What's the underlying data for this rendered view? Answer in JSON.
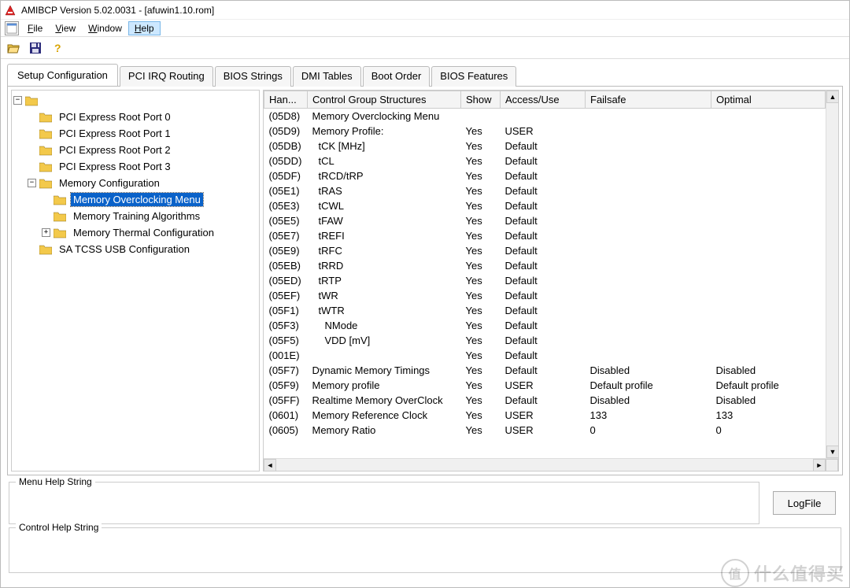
{
  "window": {
    "title": "AMIBCP Version 5.02.0031 - [afuwin1.10.rom]"
  },
  "menu": {
    "file": "File",
    "view": "View",
    "window": "Window",
    "help": "Help"
  },
  "toolbar": {
    "open_icon": "open-folder-icon",
    "save_icon": "save-icon",
    "help_icon": "help-icon"
  },
  "tabs": [
    {
      "label": "Setup Configuration",
      "active": true
    },
    {
      "label": "PCI IRQ Routing",
      "active": false
    },
    {
      "label": "BIOS Strings",
      "active": false
    },
    {
      "label": "DMI Tables",
      "active": false
    },
    {
      "label": "Boot Order",
      "active": false
    },
    {
      "label": "BIOS Features",
      "active": false
    }
  ],
  "tree": {
    "root": {
      "label": ""
    },
    "items": [
      {
        "label": "PCI Express Root Port 0",
        "depth": 1
      },
      {
        "label": "PCI Express Root Port 1",
        "depth": 1
      },
      {
        "label": "PCI Express Root Port 2",
        "depth": 1
      },
      {
        "label": "PCI Express Root Port 3",
        "depth": 1
      },
      {
        "label": "Memory Configuration",
        "depth": 1,
        "expandable": "-"
      },
      {
        "label": "Memory Overclocking Menu",
        "depth": 2,
        "selected": true
      },
      {
        "label": "Memory Training Algorithms",
        "depth": 2
      },
      {
        "label": "Memory Thermal Configuration",
        "depth": 2,
        "expandable": "+"
      },
      {
        "label": "SA TCSS USB Configuration",
        "depth": 1
      }
    ]
  },
  "table": {
    "headers": {
      "han": "Han...",
      "cgs": "Control Group Structures",
      "show": "Show",
      "access": "Access/Use",
      "failsafe": "Failsafe",
      "optimal": "Optimal"
    },
    "rows": [
      {
        "han": "(05D8)",
        "cgs": "Memory Overclocking Menu",
        "indent": 0,
        "show": "",
        "access": "",
        "failsafe": "",
        "optimal": ""
      },
      {
        "han": "(05D9)",
        "cgs": "Memory Profile:",
        "indent": 0,
        "show": "Yes",
        "access": "USER",
        "failsafe": "",
        "optimal": ""
      },
      {
        "han": "(05DB)",
        "cgs": "tCK [MHz]",
        "indent": 1,
        "show": "Yes",
        "access": "Default",
        "failsafe": "",
        "optimal": ""
      },
      {
        "han": "(05DD)",
        "cgs": "tCL",
        "indent": 1,
        "show": "Yes",
        "access": "Default",
        "failsafe": "",
        "optimal": ""
      },
      {
        "han": "(05DF)",
        "cgs": "tRCD/tRP",
        "indent": 1,
        "show": "Yes",
        "access": "Default",
        "failsafe": "",
        "optimal": ""
      },
      {
        "han": "(05E1)",
        "cgs": "tRAS",
        "indent": 1,
        "show": "Yes",
        "access": "Default",
        "failsafe": "",
        "optimal": ""
      },
      {
        "han": "(05E3)",
        "cgs": "tCWL",
        "indent": 1,
        "show": "Yes",
        "access": "Default",
        "failsafe": "",
        "optimal": ""
      },
      {
        "han": "(05E5)",
        "cgs": "tFAW",
        "indent": 1,
        "show": "Yes",
        "access": "Default",
        "failsafe": "",
        "optimal": ""
      },
      {
        "han": "(05E7)",
        "cgs": "tREFI",
        "indent": 1,
        "show": "Yes",
        "access": "Default",
        "failsafe": "",
        "optimal": ""
      },
      {
        "han": "(05E9)",
        "cgs": "tRFC",
        "indent": 1,
        "show": "Yes",
        "access": "Default",
        "failsafe": "",
        "optimal": ""
      },
      {
        "han": "(05EB)",
        "cgs": "tRRD",
        "indent": 1,
        "show": "Yes",
        "access": "Default",
        "failsafe": "",
        "optimal": ""
      },
      {
        "han": "(05ED)",
        "cgs": "tRTP",
        "indent": 1,
        "show": "Yes",
        "access": "Default",
        "failsafe": "",
        "optimal": ""
      },
      {
        "han": "(05EF)",
        "cgs": "tWR",
        "indent": 1,
        "show": "Yes",
        "access": "Default",
        "failsafe": "",
        "optimal": ""
      },
      {
        "han": "(05F1)",
        "cgs": "tWTR",
        "indent": 1,
        "show": "Yes",
        "access": "Default",
        "failsafe": "",
        "optimal": ""
      },
      {
        "han": "(05F3)",
        "cgs": "NMode",
        "indent": 2,
        "show": "Yes",
        "access": "Default",
        "failsafe": "",
        "optimal": ""
      },
      {
        "han": "(05F5)",
        "cgs": "VDD [mV]",
        "indent": 2,
        "show": "Yes",
        "access": "Default",
        "failsafe": "",
        "optimal": ""
      },
      {
        "han": "(001E)",
        "cgs": "",
        "indent": 0,
        "show": "Yes",
        "access": "Default",
        "failsafe": "",
        "optimal": ""
      },
      {
        "han": "(05F7)",
        "cgs": "Dynamic Memory Timings",
        "indent": 0,
        "show": "Yes",
        "access": "Default",
        "failsafe": "Disabled",
        "optimal": "Disabled"
      },
      {
        "han": "(05F9)",
        "cgs": "Memory profile",
        "indent": 0,
        "show": "Yes",
        "access": "USER",
        "failsafe": "Default profile",
        "optimal": "Default profile"
      },
      {
        "han": "(05FF)",
        "cgs": "Realtime Memory OverClock",
        "indent": 0,
        "show": "Yes",
        "access": "Default",
        "failsafe": "Disabled",
        "optimal": "Disabled"
      },
      {
        "han": "(0601)",
        "cgs": "Memory Reference Clock",
        "indent": 0,
        "show": "Yes",
        "access": "USER",
        "failsafe": "133",
        "optimal": "133"
      },
      {
        "han": "(0605)",
        "cgs": "Memory Ratio",
        "indent": 0,
        "show": "Yes",
        "access": "USER",
        "failsafe": "0",
        "optimal": "0"
      }
    ]
  },
  "groupboxes": {
    "menuhelp_label": "Menu Help String",
    "controlhelp_label": "Control Help String",
    "logfile_label": "LogFile"
  },
  "watermark": {
    "circle": "值",
    "text": "什么值得买"
  }
}
